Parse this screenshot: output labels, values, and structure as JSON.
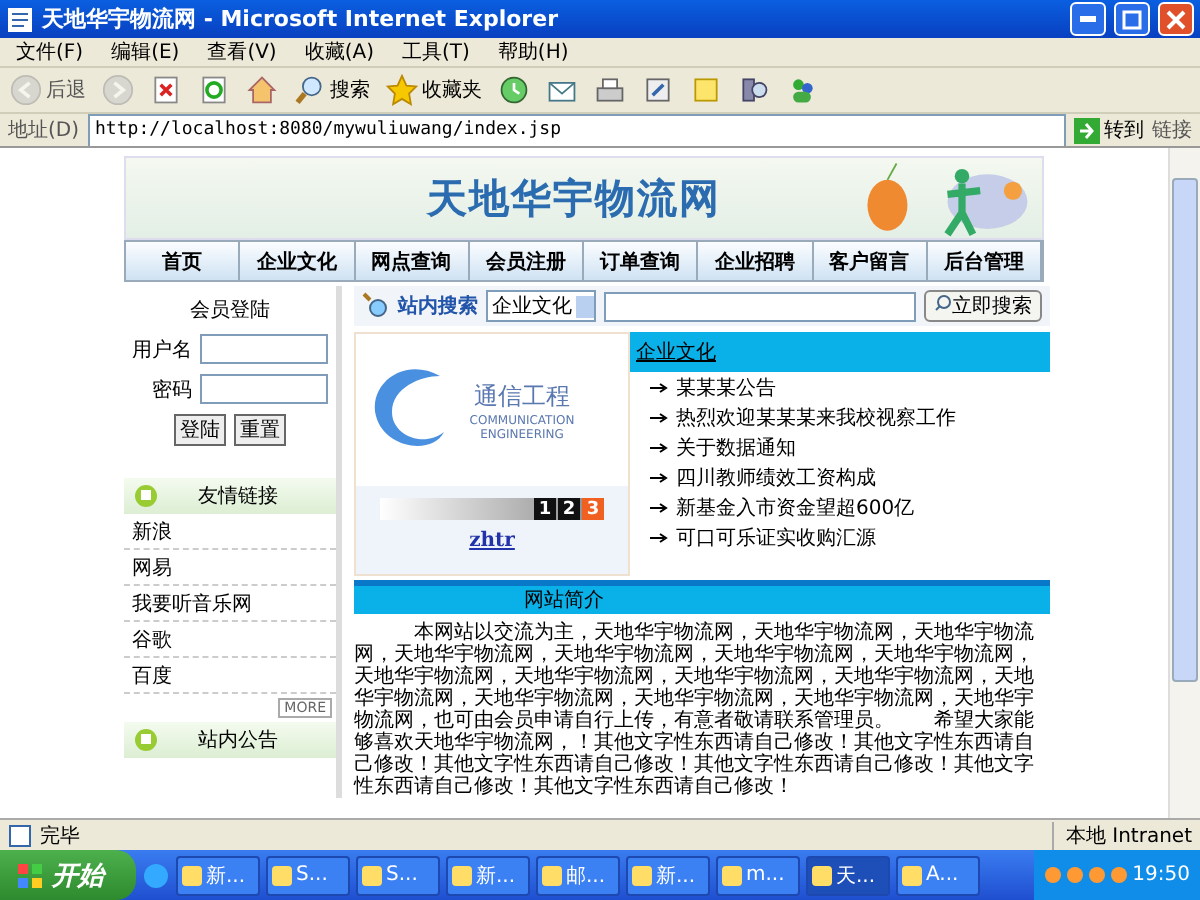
{
  "window": {
    "title": "天地华宇物流网 - Microsoft Internet Explorer"
  },
  "menu_bar": [
    "文件(F)",
    "编辑(E)",
    "查看(V)",
    "收藏(A)",
    "工具(T)",
    "帮助(H)"
  ],
  "toolbar": [
    {
      "kind": "back",
      "label": "后退",
      "disabled": true
    },
    {
      "kind": "forward",
      "disabled": true
    },
    {
      "kind": "stop",
      "disabled": false
    },
    {
      "kind": "refresh",
      "disabled": false
    },
    {
      "kind": "home",
      "disabled": false
    },
    {
      "kind": "search",
      "label": "搜索",
      "disabled": false
    },
    {
      "kind": "favorites",
      "label": "收藏夹",
      "disabled": false
    },
    {
      "kind": "history",
      "disabled": false
    },
    {
      "kind": "mail",
      "disabled": false
    },
    {
      "kind": "print",
      "disabled": false
    },
    {
      "kind": "edit",
      "disabled": false
    },
    {
      "kind": "note",
      "disabled": false
    },
    {
      "kind": "research",
      "disabled": false
    },
    {
      "kind": "messenger",
      "disabled": false
    }
  ],
  "address_bar": {
    "label": "地址(D)",
    "value": "http://localhost:8080/mywuliuwang/index.jsp",
    "go": "转到",
    "links": "链接"
  },
  "page": {
    "site_title": "天地华宇物流网",
    "nav": [
      "首页",
      "企业文化",
      "网点查询",
      "会员注册",
      "订单查询",
      "企业招聘",
      "客户留言",
      "后台管理"
    ],
    "login": {
      "title": "会员登陆",
      "username_label": "用户名",
      "password_label": "密码",
      "buttons": [
        "登陆",
        "重置"
      ]
    },
    "friend_links": {
      "title": "友情链接",
      "items": [
        "新浪",
        "网易",
        "我要听音乐网",
        "谷歌",
        "百度"
      ],
      "more": "MORE"
    },
    "notice": {
      "title": "站内公告"
    },
    "search": {
      "label": "站内搜索",
      "category": "企业文化",
      "button": "立即搜索"
    },
    "slideshow": {
      "logo_title": "通信工程",
      "logo_subtitle": "COMMUNICATION ENGINEERING",
      "pages": [
        {
          "label": "1",
          "selected": false
        },
        {
          "label": "2",
          "selected": false
        },
        {
          "label": "3",
          "selected": true
        }
      ],
      "caption": "zhtr"
    },
    "news": {
      "title": "企业文化",
      "items": [
        "某某某公告",
        "热烈欢迎某某某来我校视察工作",
        "关于数据通知",
        "四川教师绩效工资构成",
        "新基金入市资金望超600亿",
        "可口可乐证实收购汇源"
      ]
    },
    "intro": {
      "title": "网站简介",
      "text": "本网站以交流为主，天地华宇物流网，天地华宇物流网，天地华宇物流网，天地华宇物流网，天地华宇物流网，天地华宇物流网，天地华宇物流网，天地华宇物流网，天地华宇物流网，天地华宇物流网，天地华宇物流网，天地华宇物流网，天地华宇物流网，天地华宇物流网，天地华宇物流网，天地华宇物流网，也可由会员申请自行上传，有意者敬请联系管理员。　　希望大家能够喜欢天地华宇物流网，！其他文字性东西请自己修改！其他文字性东西请自己修改！其他文字性东西请自己修改！其他文字性东西请自己修改！其他文字性东西请自己修改！其他文字性东西请自己修改！"
    }
  },
  "status_bar": {
    "text": "完毕",
    "zone": "本地 Intranet"
  },
  "taskbar": {
    "start": "开始",
    "tasks": [
      {
        "label": "新...",
        "selected": false
      },
      {
        "label": "S...",
        "selected": false
      },
      {
        "label": "S...",
        "selected": false
      },
      {
        "label": "新...",
        "selected": false
      },
      {
        "label": "邮...",
        "selected": false
      },
      {
        "label": "新...",
        "selected": false
      },
      {
        "label": "m...",
        "selected": false
      },
      {
        "label": "天...",
        "selected": true
      },
      {
        "label": "A...",
        "selected": false
      }
    ],
    "clock": "19:50"
  }
}
